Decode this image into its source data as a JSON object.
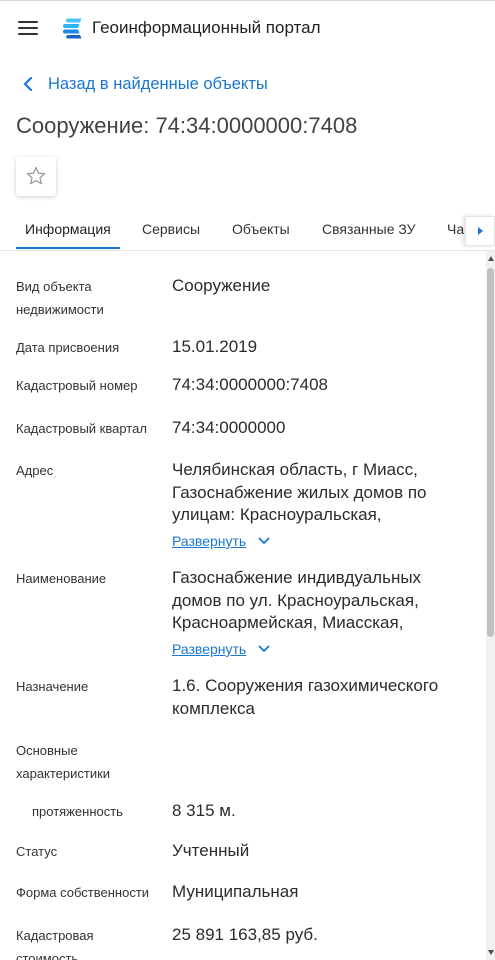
{
  "header": {
    "title": "Геоинформационный портал",
    "menu_icon": "hamburger-menu-icon",
    "logo_icon": "geoportal-logo-icon"
  },
  "back_link": {
    "label": "Назад в найденные объекты",
    "icon": "chevron-left-icon"
  },
  "page_title": "Сооружение: 74:34:0000000:7408",
  "favorite_button": {
    "icon": "star-outline-icon"
  },
  "tabs": [
    {
      "label": "Информация",
      "active": true
    },
    {
      "label": "Сервисы",
      "active": false
    },
    {
      "label": "Объекты",
      "active": false
    },
    {
      "label": "Связанные ЗУ",
      "active": false
    },
    {
      "label": "Ча",
      "active": false
    }
  ],
  "tabs_scroll": {
    "icon": "triangle-right-icon"
  },
  "info": {
    "rows": [
      {
        "label": "Вид объекта недвижимости",
        "value": "Сооружение"
      },
      {
        "label": "Дата присвоения",
        "value": "15.01.2019"
      },
      {
        "label": "Кадастровый номер",
        "value": "74:34:0000000:7408"
      },
      {
        "label": "Кадастровый квартал",
        "value": "74:34:0000000"
      },
      {
        "label": "Адрес",
        "value": "Челябинская область, г Миасс, Газоснабжение жилых домов по улицам: Красноуральская,",
        "expand_label": "Развернуть",
        "expand_icon": "chevron-down-icon"
      },
      {
        "label": "Наименование",
        "value": "Газоснабжение индивдуальных домов по ул. Красноуральская, Красноармейская, Миасская,",
        "expand_label": "Развернуть",
        "expand_icon": "chevron-down-icon"
      },
      {
        "label": "Назначение",
        "value": "1.6. Сооружения газохимического комплекса"
      },
      {
        "label": "Основные характеристики"
      },
      {
        "label": "протяженность",
        "value": "8 315 м."
      },
      {
        "label": "Статус",
        "value": "Учтенный"
      },
      {
        "label": "Форма собственности",
        "value": "Муниципальная"
      },
      {
        "label": "Кадастровая стоимость",
        "value": "25 891 163,85 руб."
      }
    ]
  },
  "scrollbar": {
    "up_icon": "triangle-up-icon",
    "down_icon": "triangle-down-icon"
  },
  "colors": {
    "accent": "#1976d2",
    "text": "#2b2b2b",
    "label": "#333333",
    "title": "#424242",
    "divider": "#e6e6e6",
    "scroll_thumb": "#c1c1c1",
    "icon_gray": "#9e9e9e"
  }
}
